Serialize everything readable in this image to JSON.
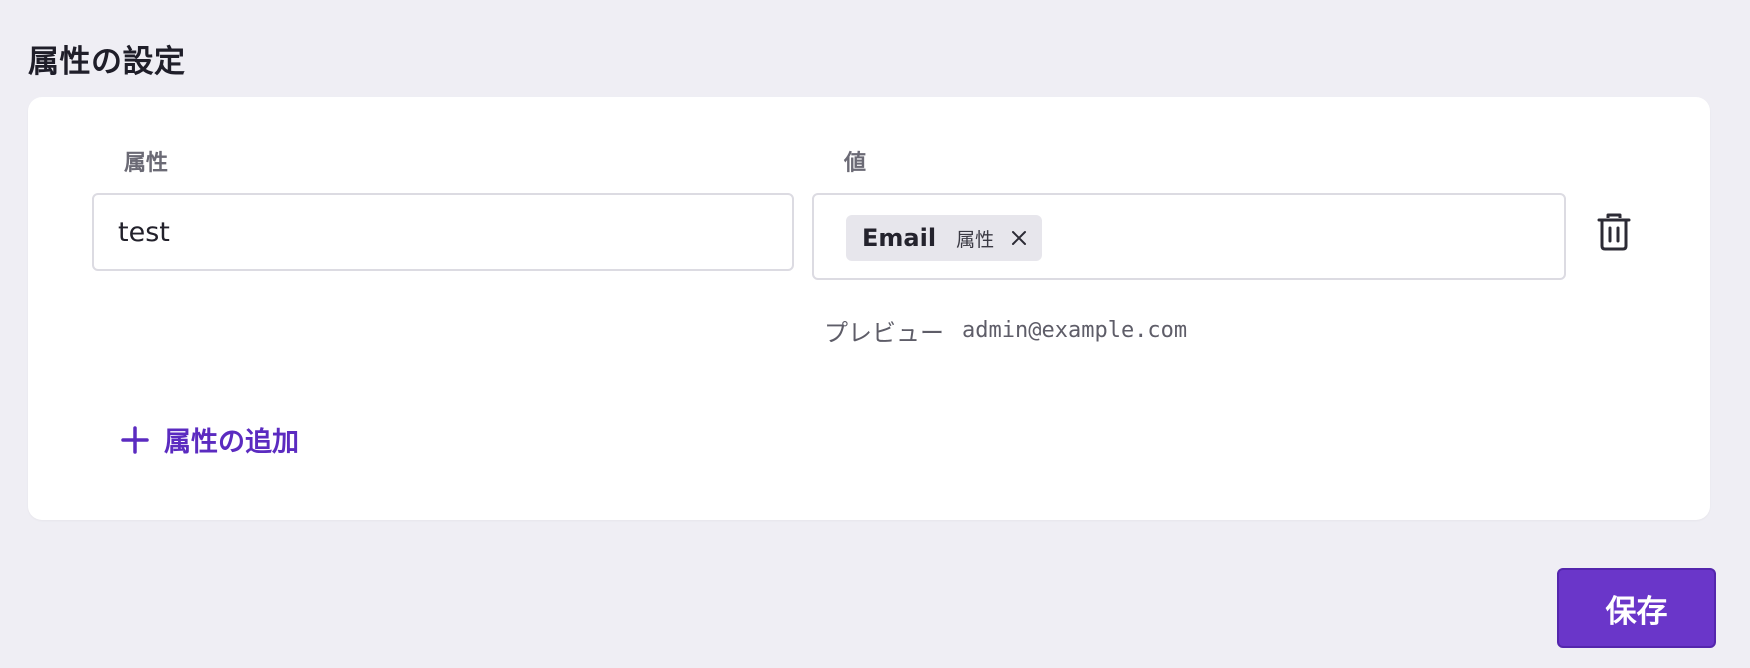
{
  "page": {
    "title": "属性の設定"
  },
  "columns": {
    "attribute_label": "属性",
    "value_label": "値"
  },
  "row": {
    "attribute_value": "test",
    "chip": {
      "name": "Email",
      "tag": "属性"
    },
    "preview_label": "プレビュー",
    "preview_value": "admin@example.com"
  },
  "actions": {
    "add_label": "属性の追加",
    "save_label": "保存"
  },
  "colors": {
    "accent": "#6a36c9",
    "accent_text": "#5b2bc0",
    "background": "#efeef4",
    "card": "#ffffff",
    "chip": "#e7e6ec"
  },
  "icons": {
    "chip_remove": "close-icon",
    "delete_row": "trash-icon",
    "add": "plus-icon"
  }
}
